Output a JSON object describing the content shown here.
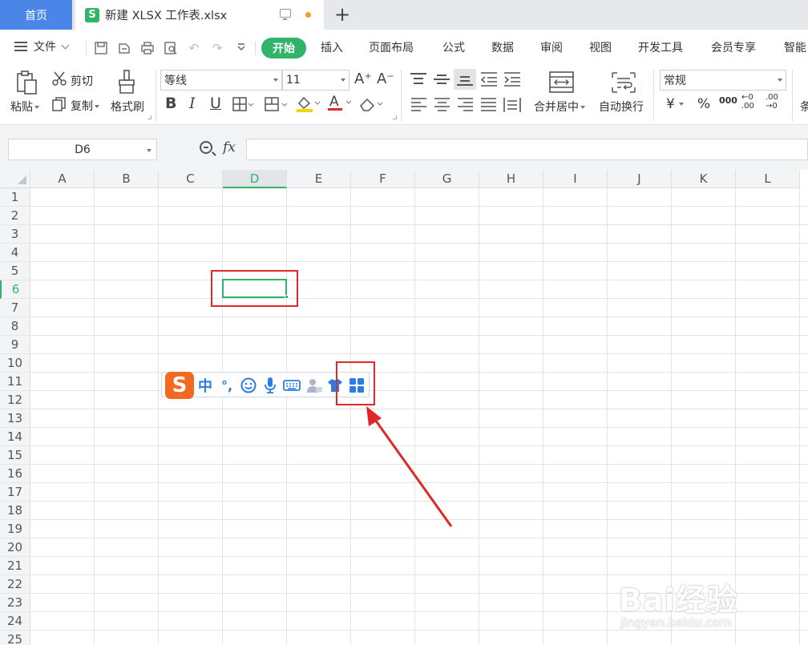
{
  "tabs": {
    "home": "首页",
    "doc_title": "新建 XLSX 工作表.xlsx",
    "logo": "S",
    "add": "+"
  },
  "menu": {
    "file": "文件",
    "start": "开始",
    "items": [
      "插入",
      "页面布局",
      "公式",
      "数据",
      "审阅",
      "视图",
      "开发工具",
      "会员专享",
      "智能"
    ]
  },
  "ribbon": {
    "paste": "粘贴",
    "cut": "剪切",
    "copy": "复制",
    "format_painter": "格式刷",
    "font_name": "等线",
    "font_size": "11",
    "merge_center": "合并居中",
    "wrap_text": "自动换行",
    "number_format": "常规",
    "currency": "¥",
    "percent": "%",
    "thousands": "000",
    "inc_decimal": "←0 .00",
    "dec_decimal": ".00 →0",
    "cond": "条"
  },
  "formula_bar": {
    "name_box": "D6",
    "fx": "fx",
    "formula": ""
  },
  "grid": {
    "columns": [
      "A",
      "B",
      "C",
      "D",
      "E",
      "F",
      "G",
      "H",
      "I",
      "J",
      "K",
      "L"
    ],
    "rows": [
      "1",
      "2",
      "3",
      "4",
      "5",
      "6",
      "7",
      "8",
      "9",
      "10",
      "11",
      "12",
      "13",
      "14",
      "15",
      "16",
      "17",
      "18",
      "19",
      "20",
      "21",
      "22",
      "23",
      "24",
      "25"
    ],
    "active_cell": "D6",
    "active_column": "D",
    "active_row": "6"
  },
  "ime_toolbar": {
    "logo": "S",
    "mode": "中",
    "punct": "°,"
  },
  "watermark": {
    "brand": "Bai经验",
    "url": "jingyan.baidu.com"
  },
  "colors": {
    "accent": "#2fb46a",
    "tab_active": "#4a86e8",
    "annotation": "#e02828",
    "ime": "#f26a21"
  }
}
